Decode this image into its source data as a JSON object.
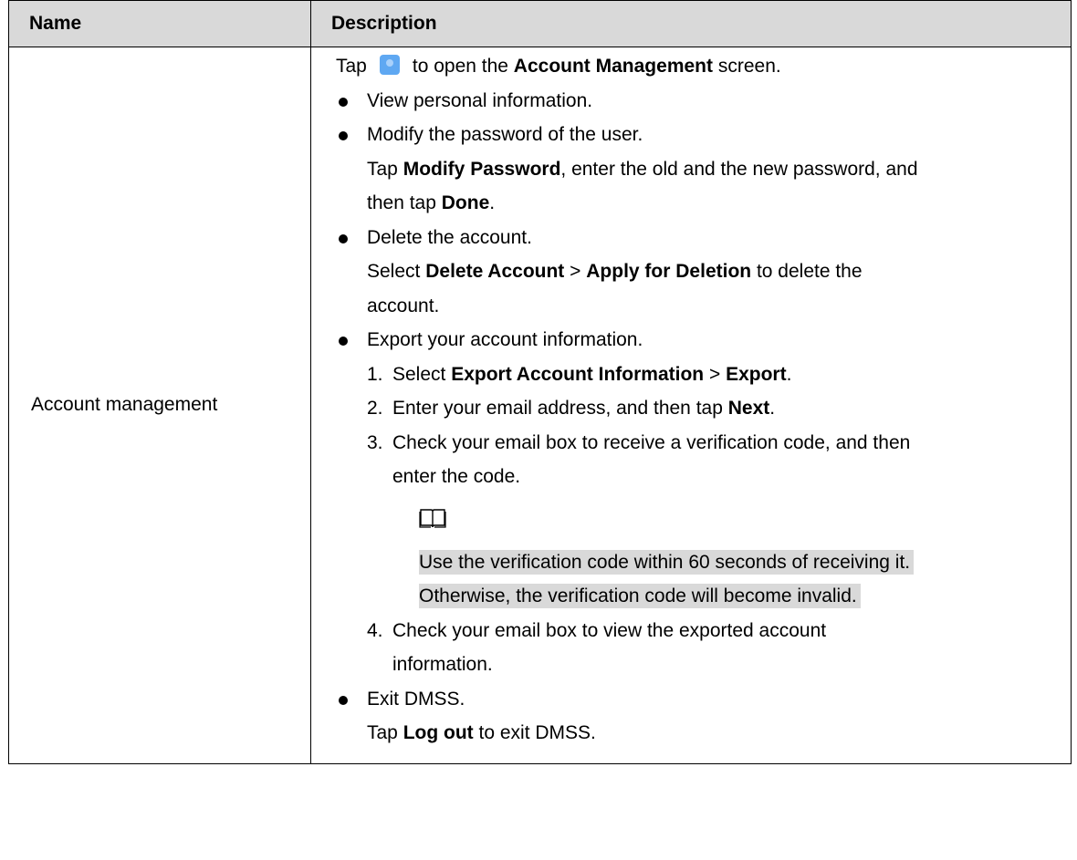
{
  "header": {
    "name": "Name",
    "description": "Description"
  },
  "row": {
    "name": "Account management",
    "intro": {
      "pre": "Tap",
      "post": "to open the",
      "bold": "Account Management",
      "tail": "screen."
    },
    "b1": "View personal information.",
    "b2": "Modify the password of the user.",
    "b2_detail": {
      "pre": "Tap",
      "bold1": "Modify Password",
      "mid": ", enter the old and the new password, and",
      "line2_pre": "then tap",
      "bold2": "Done",
      "end": "."
    },
    "b3": "Delete the account.",
    "b3_detail": {
      "pre": "Select",
      "bold1": "Delete Account",
      "sep": ">",
      "bold2": "Apply for Deletion",
      "post": "to delete the",
      "line2": "account."
    },
    "b4": "Export your account information.",
    "steps": [
      {
        "num": "1.",
        "pre": "Select",
        "bold1": "Export Account Information",
        "sep": ">",
        "bold2": "Export",
        "end": "."
      },
      {
        "num": "2.",
        "pre": "Enter your email address, and then tap",
        "bold1": "Next",
        "end": "."
      },
      {
        "num": "3.",
        "line1": "Check your email box to receive a verification code, and then",
        "line2": "enter the code."
      },
      {
        "num": "4.",
        "line1": "Check your email box to view the exported account",
        "line2": "information."
      }
    ],
    "note": {
      "line1": "Use the verification code within 60 seconds of receiving it.",
      "line2": "Otherwise, the verification code will become invalid."
    },
    "b5": "Exit DMSS.",
    "b5_detail": {
      "pre": "Tap",
      "bold": "Log out",
      "post": "to exit DMSS."
    }
  },
  "icons": {
    "user": "user-avatar-icon",
    "note": "open-book-icon",
    "user_color": "#5fa8f2"
  }
}
